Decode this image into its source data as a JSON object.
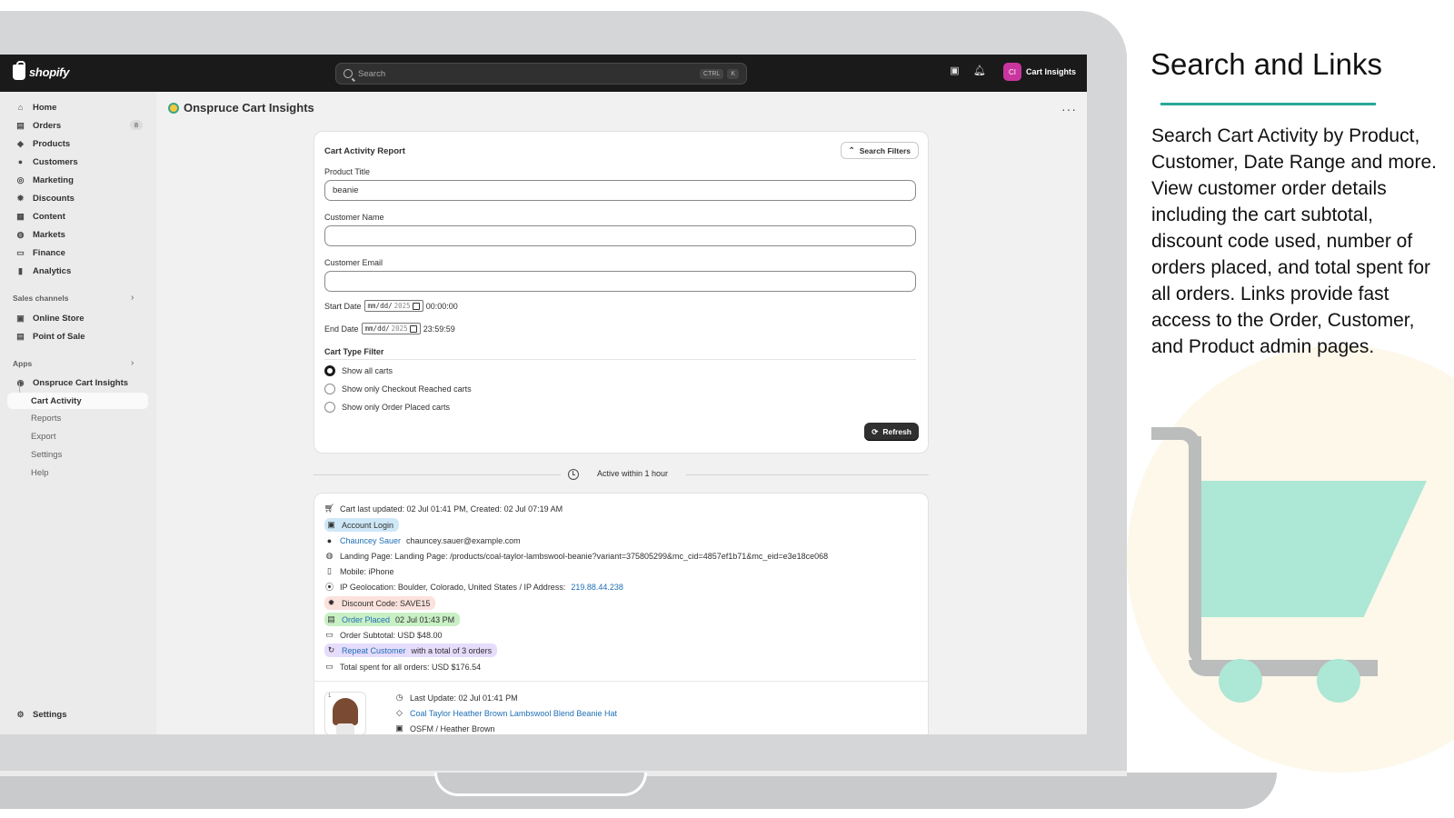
{
  "topbar": {
    "logo": "shopify",
    "search_placeholder": "Search",
    "kbd1": "CTRL",
    "kbd2": "K",
    "avatar_initials": "CI",
    "user_name": "Cart Insights"
  },
  "sidebar": {
    "items": [
      {
        "label": "Home",
        "icon": "home-icon"
      },
      {
        "label": "Orders",
        "icon": "orders-icon",
        "badge": "8"
      },
      {
        "label": "Products",
        "icon": "tag-icon"
      },
      {
        "label": "Customers",
        "icon": "person-icon"
      },
      {
        "label": "Marketing",
        "icon": "target-icon"
      },
      {
        "label": "Discounts",
        "icon": "discount-icon"
      },
      {
        "label": "Content",
        "icon": "content-icon"
      },
      {
        "label": "Markets",
        "icon": "globe-icon"
      },
      {
        "label": "Finance",
        "icon": "bank-icon"
      },
      {
        "label": "Analytics",
        "icon": "bar-chart-icon"
      }
    ],
    "sales_channels_label": "Sales channels",
    "sales_channels": [
      {
        "label": "Online Store",
        "icon": "store-icon"
      },
      {
        "label": "Point of Sale",
        "icon": "pos-icon"
      }
    ],
    "apps_label": "Apps",
    "app_name": "Onspruce Cart Insights",
    "app_active": "Cart Activity",
    "app_subitems": [
      "Reports",
      "Export",
      "Settings",
      "Help"
    ],
    "settings_label": "Settings"
  },
  "page": {
    "title": "Onspruce Cart Insights",
    "more": "···"
  },
  "filters": {
    "card_title": "Cart Activity Report",
    "toggle_label": "Search Filters",
    "product_title_label": "Product Title",
    "product_title_value": "beanie",
    "customer_name_label": "Customer Name",
    "customer_name_value": "",
    "customer_email_label": "Customer Email",
    "customer_email_value": "",
    "start_date_label": "Start Date",
    "start_date_mmdd": "mm/dd/",
    "start_date_year": "2025",
    "start_time": "00:00:00",
    "end_date_label": "End Date",
    "end_date_mmdd": "mm/dd/",
    "end_date_year": "2025",
    "end_time": "23:59:59",
    "cart_type_label": "Cart Type Filter",
    "options": [
      "Show all carts",
      "Show only Checkout Reached carts",
      "Show only Order Placed carts"
    ],
    "selected_option": 0,
    "refresh_label": "Refresh"
  },
  "divider": {
    "label": "Active within 1 hour"
  },
  "activity": {
    "cart_updated": "Cart last updated: 02 Jul 01:41 PM, Created: 02 Jul 07:19 AM",
    "account_login": "Account Login",
    "customer_name": "Chauncey Sauer",
    "customer_email": "chauncey.sauer@example.com",
    "landing_page": "Landing Page: Landing Page: /products/coal-taylor-lambswool-beanie?variant=375805299&mc_cid=4857ef1b71&mc_eid=e3e18ce068",
    "device": "Mobile: iPhone",
    "geo_prefix": "IP Geolocation: Boulder, Colorado, United States / IP Address:",
    "ip": "219.88.44.238",
    "discount": "Discount Code: SAVE15",
    "order_placed_link": "Order Placed",
    "order_placed_time": "02 Jul 01:43 PM",
    "order_subtotal": "Order Subtotal: USD $48.00",
    "repeat_link": "Repeat Customer",
    "repeat_text": "with a total of 3 orders",
    "total_spent": "Total spent for all orders: USD $176.54",
    "item_number": "1",
    "item_last_update": "Last Update: 02 Jul 01:41 PM",
    "item_title": "Coal Taylor Heather Brown Lambswool Blend Beanie Hat",
    "item_variant": "OSFM / Heather Brown"
  },
  "right_panel": {
    "title": "Search and Links",
    "body": "Search Cart Activity by Product, Customer, Date Range and more.  View customer order details including the cart subtotal, discount code used, number of orders placed, and total spent for all orders.  Links provide fast access to the Order, Customer, and Product admin pages."
  },
  "colors": {
    "accent_teal": "#2aa89a",
    "cart_mint": "#ade7d5",
    "topbar": "#1a1a1a",
    "link_blue": "#1f6fb5",
    "avatar_magenta": "#c9359f"
  }
}
